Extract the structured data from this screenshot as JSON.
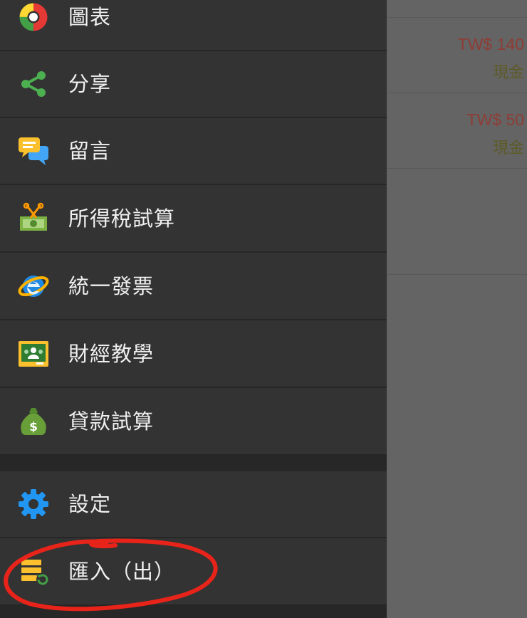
{
  "drawer": {
    "items": [
      {
        "label": "圖表",
        "icon": "pie-chart-icon"
      },
      {
        "label": "分享",
        "icon": "share-icon"
      },
      {
        "label": "留言",
        "icon": "chat-bubbles-icon"
      },
      {
        "label": "所得稅試算",
        "icon": "money-scissors-icon"
      },
      {
        "label": "統一發票",
        "icon": "internet-explorer-icon"
      },
      {
        "label": "財經教學",
        "icon": "classroom-board-icon"
      },
      {
        "label": "貸款試算",
        "icon": "money-bag-icon"
      },
      {
        "label": "設定",
        "icon": "gear-icon"
      },
      {
        "label": "匯入（出）",
        "icon": "import-export-icon"
      }
    ]
  },
  "background": {
    "rows": [
      {
        "amount": "TW$ 140",
        "payment": "現金"
      },
      {
        "amount": "TW$ 50",
        "payment": "現金"
      }
    ]
  },
  "colors": {
    "drawer_bg": "#333333",
    "annotation_red": "#e8241a",
    "amount_red": "#8e3d36"
  }
}
